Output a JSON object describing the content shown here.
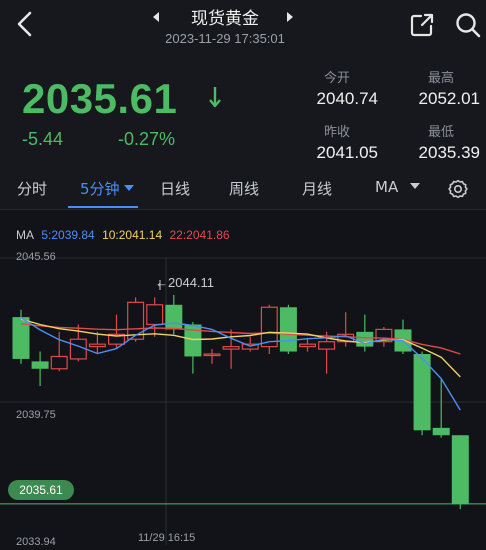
{
  "header": {
    "title": "现货黄金",
    "datetime": "2023-11-29 17:35:01"
  },
  "quote": {
    "price": "2035.61",
    "change": "-5.44",
    "change_pct": "-0.27%",
    "open_label": "今开",
    "open_value": "2040.74",
    "high_label": "最高",
    "high_value": "2052.01",
    "prev_close_label": "昨收",
    "prev_close_value": "2041.05",
    "low_label": "最低",
    "low_value": "2035.39"
  },
  "tabs": {
    "t1": "分时",
    "t2": "5分钟",
    "t3": "日线",
    "t4": "周线",
    "t5": "月线",
    "t6": "MA"
  },
  "chart": {
    "ma_label": "MA",
    "ma5": "5:2039.84",
    "ma10": "10:2041.14",
    "ma22": "22:2041.86",
    "y_top": "2045.56",
    "y_mid": "2039.75",
    "y_bottom": "2033.94",
    "current_price": "2035.61",
    "peak_label": "←2044.11",
    "x_time": "11/29 16:15"
  },
  "colors": {
    "up": "#e04a4a",
    "down": "#4cbb64",
    "accent": "#4a8ff5"
  },
  "chart_data": {
    "type": "candlestick",
    "ylim": [
      2033.94,
      2045.56
    ],
    "candles": [
      {
        "open": 2043.2,
        "close": 2041.5,
        "high": 2043.5,
        "low": 2041.3
      },
      {
        "open": 2041.4,
        "close": 2041.1,
        "high": 2041.8,
        "low": 2040.4
      },
      {
        "open": 2041.1,
        "close": 2041.6,
        "high": 2042.6,
        "low": 2041.0
      },
      {
        "open": 2041.5,
        "close": 2042.3,
        "high": 2042.9,
        "low": 2041.4
      },
      {
        "open": 2042.0,
        "close": 2042.1,
        "high": 2042.6,
        "low": 2041.7
      },
      {
        "open": 2042.1,
        "close": 2042.5,
        "high": 2043.3,
        "low": 2041.9
      },
      {
        "open": 2042.3,
        "close": 2043.8,
        "high": 2044.0,
        "low": 2042.2
      },
      {
        "open": 2042.9,
        "close": 2043.7,
        "high": 2044.0,
        "low": 2042.4
      },
      {
        "open": 2043.7,
        "close": 2042.7,
        "high": 2044.1,
        "low": 2042.5
      },
      {
        "open": 2042.9,
        "close": 2041.6,
        "high": 2043.0,
        "low": 2040.9
      },
      {
        "open": 2041.7,
        "close": 2041.7,
        "high": 2041.9,
        "low": 2041.3
      },
      {
        "open": 2041.9,
        "close": 2042.0,
        "high": 2042.7,
        "low": 2041.1
      },
      {
        "open": 2041.9,
        "close": 2042.1,
        "high": 2042.4,
        "low": 2041.8
      },
      {
        "open": 2042.0,
        "close": 2043.6,
        "high": 2043.7,
        "low": 2041.7
      },
      {
        "open": 2043.6,
        "close": 2041.8,
        "high": 2043.7,
        "low": 2041.7
      },
      {
        "open": 2042.0,
        "close": 2042.1,
        "high": 2042.3,
        "low": 2041.8
      },
      {
        "open": 2041.9,
        "close": 2042.2,
        "high": 2042.6,
        "low": 2040.9
      },
      {
        "open": 2042.2,
        "close": 2042.5,
        "high": 2043.4,
        "low": 2042.0
      },
      {
        "open": 2042.6,
        "close": 2042.0,
        "high": 2043.3,
        "low": 2041.8
      },
      {
        "open": 2042.2,
        "close": 2042.7,
        "high": 2042.8,
        "low": 2042.0
      },
      {
        "open": 2042.7,
        "close": 2041.8,
        "high": 2043.1,
        "low": 2041.7
      },
      {
        "open": 2041.7,
        "close": 2038.6,
        "high": 2041.8,
        "low": 2038.4
      },
      {
        "open": 2038.7,
        "close": 2038.4,
        "high": 2040.7,
        "low": 2038.3
      },
      {
        "open": 2038.4,
        "close": 2035.6,
        "high": 2038.4,
        "low": 2035.4
      }
    ]
  }
}
